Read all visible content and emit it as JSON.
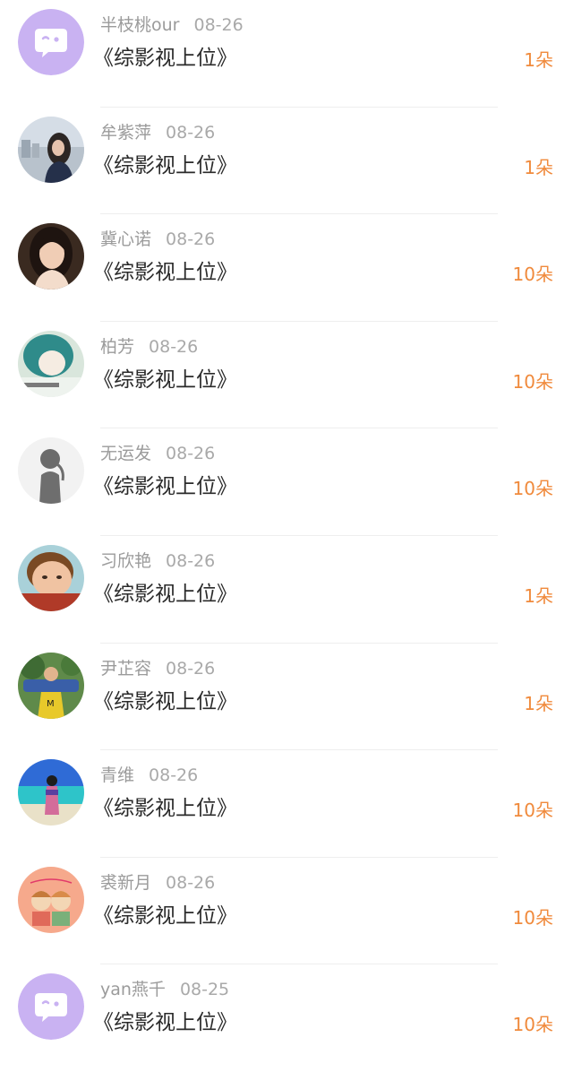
{
  "items": [
    {
      "avatar": "default-chat-icon",
      "name": "半枝桃our",
      "date": "08-26",
      "title": "《综影视上位》",
      "gift": "1朵"
    },
    {
      "avatar": "photo-woman-icon",
      "name": "牟紫萍",
      "date": "08-26",
      "title": "《综影视上位》",
      "gift": "1朵"
    },
    {
      "avatar": "photo-portrait-icon",
      "name": "冀心诺",
      "date": "08-26",
      "title": "《综影视上位》",
      "gift": "10朵"
    },
    {
      "avatar": "photo-anime-girl-icon",
      "name": "柏芳",
      "date": "08-26",
      "title": "《综影视上位》",
      "gift": "10朵"
    },
    {
      "avatar": "photo-silhouette-icon",
      "name": "无运发",
      "date": "08-26",
      "title": "《综影视上位》",
      "gift": "10朵"
    },
    {
      "avatar": "photo-child-icon",
      "name": "习欣艳",
      "date": "08-26",
      "title": "《综影视上位》",
      "gift": "1朵"
    },
    {
      "avatar": "photo-person-outdoor-icon",
      "name": "尹芷容",
      "date": "08-26",
      "title": "《综影视上位》",
      "gift": "1朵"
    },
    {
      "avatar": "photo-beach-icon",
      "name": "青维",
      "date": "08-26",
      "title": "《综影视上位》",
      "gift": "10朵"
    },
    {
      "avatar": "illustration-cartoon-icon",
      "name": "裘新月",
      "date": "08-26",
      "title": "《综影视上位》",
      "gift": "10朵"
    },
    {
      "avatar": "default-chat-icon",
      "name": "yan燕千",
      "date": "08-25",
      "title": "《综影视上位》",
      "gift": "10朵"
    }
  ],
  "colors": {
    "gift": "#f08a3c",
    "default_avatar": "#c9b2f2"
  }
}
